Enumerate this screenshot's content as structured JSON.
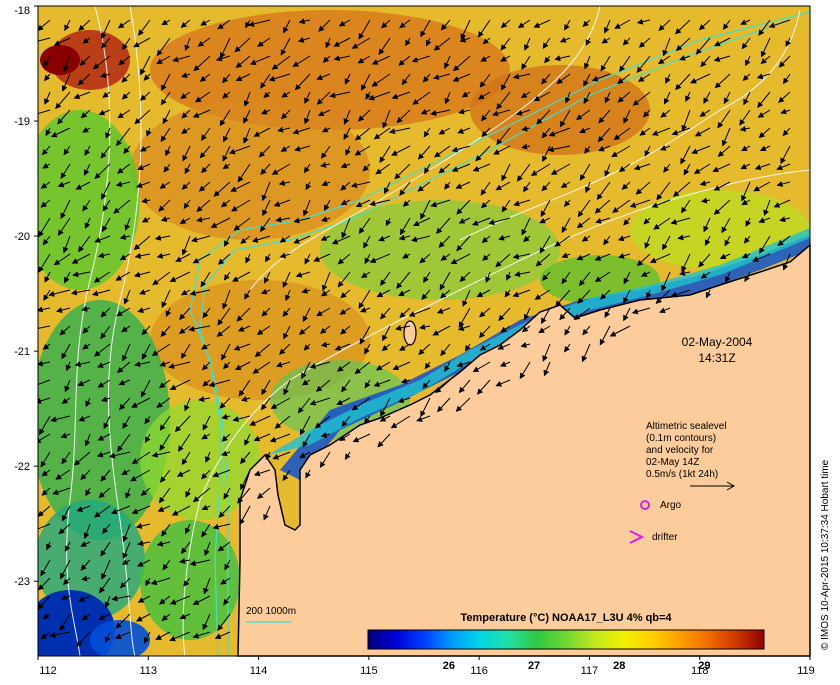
{
  "date": "02-May-2004",
  "time": "14:31Z",
  "legend": {
    "line1": "Altimetric sealevel",
    "line2": "(0.1m contours)",
    "line3": "and velocity for",
    "line4": "02-May 14Z",
    "line5": "0.5m/s (1kt 24h)",
    "argo": "Argo",
    "drifter": "drifter"
  },
  "bathy_label": "200  1000m",
  "colorbar": {
    "title": "Temperature (°C) NOAA17_L3U 4% qb=4",
    "ticks": [
      "26",
      "27",
      "28",
      "29"
    ],
    "tick_values": [
      26,
      27,
      28,
      29
    ],
    "range": [
      25.05,
      29.7
    ],
    "colors": [
      "#00007f",
      "#0000d8",
      "#0040ff",
      "#00a0ff",
      "#00d8e0",
      "#20e0a0",
      "#30c840",
      "#70d830",
      "#c0e820",
      "#f0f000",
      "#ffd000",
      "#ffa000",
      "#f07000",
      "#d03800",
      "#900000"
    ]
  },
  "axes": {
    "x_ticks": [
      "112",
      "113",
      "114",
      "115",
      "116",
      "117",
      "118",
      "119"
    ],
    "x_values": [
      112,
      113,
      114,
      115,
      116,
      117,
      118,
      119
    ],
    "y_ticks": [
      "-18",
      "-19",
      "-20",
      "-21",
      "-22",
      "-23"
    ],
    "y_values": [
      -18,
      -19,
      -20,
      -21,
      -22,
      -23
    ],
    "lon_range": [
      112,
      119
    ],
    "lat_range": [
      -23.65,
      -18
    ]
  },
  "credit": "© IMOS 10-Apr-2015 10:37:34 Hobart time",
  "colors": {
    "land": "#fdcc9d",
    "bathy": "#40e0d0",
    "sst_warm": "#e89a20",
    "sst_cool": "#1a60d0",
    "argo": "#e020e0",
    "drifter": "#e020e0"
  }
}
